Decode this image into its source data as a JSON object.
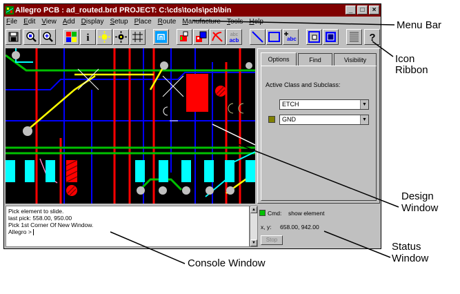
{
  "window": {
    "title": "Allegro PCB : ad_routed.brd  PROJECT: C:\\cds\\tools\\pcb\\bin",
    "controls": [
      "_",
      "□",
      "×"
    ]
  },
  "menu": [
    "File",
    "Edit",
    "View",
    "Add",
    "Display",
    "Setup",
    "Place",
    "Route",
    "Manufacture",
    "Tools",
    "Help"
  ],
  "ribbon": {
    "icons": [
      "save-icon",
      "zoom-fit-icon",
      "zoom-in-icon",
      "color-icon",
      "info-icon",
      "highlight-icon",
      "dehighlight-icon",
      "grid-icon",
      "shadow-icon",
      "move-icon",
      "copy-icon",
      "delete-icon",
      "text-edit-icon",
      "line-icon",
      "rectangle-icon",
      "add-text-icon",
      "zoom-window-icon",
      "fill-icon",
      "layer-icon",
      "help-icon"
    ],
    "text_icon_labels": {
      "info": "i",
      "abc_top": "abc",
      "abc_bottom": "acb",
      "add_text": "abc",
      "help": "?"
    }
  },
  "panel": {
    "tabs": [
      "Options",
      "Find",
      "Visibility"
    ],
    "active_label": "Active Class and Subclass:",
    "class_value": "ETCH",
    "subclass_value": "GND"
  },
  "console": {
    "lines": [
      "Pick element to slide.",
      "last pick:  558.00, 950.00",
      "Pick 1st Corner Of New Window.",
      "Allegro > "
    ]
  },
  "status": {
    "cmd_label": "Cmd:",
    "cmd_value": "show element",
    "xy_label": "x, y:",
    "xy_value": "658.00, 942.00",
    "stop_label": "Stop"
  },
  "callouts": {
    "menu_bar": "Menu Bar",
    "icon_ribbon_1": "Icon",
    "icon_ribbon_2": "Ribbon",
    "design_window_1": "Design",
    "design_window_2": "Window",
    "console_window": "Console Window",
    "status_window_1": "Status",
    "status_window_2": "Window"
  },
  "colors": {
    "titlebar": "#800000",
    "pcb_background": "#000000",
    "etch_yellow": "#ffff00",
    "etch_blue": "#0000ff",
    "etch_red": "#ff0000",
    "etch_green": "#00c000",
    "pad_cyan": "#00ffff",
    "subclass_swatch": "#808000"
  }
}
